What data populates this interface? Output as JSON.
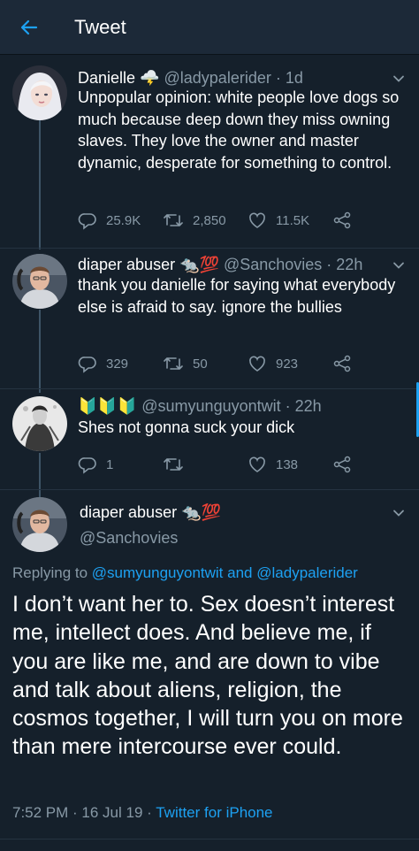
{
  "header": {
    "title": "Tweet"
  },
  "tweets": [
    {
      "name": "Danielle",
      "emoji": "🌩️",
      "handle": "@ladypalerider",
      "time": "· 1d",
      "text": "Unpopular opinion: white people love dogs so much because deep down they miss owning slaves. They love the owner and master dynamic, desperate for something to control.",
      "replies": "25.9K",
      "retweets": "2,850",
      "likes": "11.5K"
    },
    {
      "name": "diaper abuser",
      "emoji": "🐀💯",
      "handle": "@Sanchovies",
      "time": "· 22h",
      "text": "thank you danielle for saying what everybody else is afraid to say. ignore the bullies",
      "replies": "329",
      "retweets": "50",
      "likes": "923"
    },
    {
      "name": "🔰🔰🔰",
      "handle": "@sumyunguyontwit",
      "time": "· 22h",
      "text": "Shes not gonna suck your dick",
      "replies": "1",
      "retweets": "",
      "likes": "138"
    }
  ],
  "main_tweet": {
    "name": "diaper abuser",
    "emoji": "🐀💯",
    "handle": "@Sanchovies",
    "replying_prefix": "Replying to",
    "replying_user1": "@sumyunguyontwit",
    "replying_and": "and",
    "replying_user2": "@ladypalerider",
    "text": "I don’t want her to. Sex doesn’t interest me, intellect does. And believe me, if you are like me, and are down to vibe and talk about aliens, religion, the cosmos together, I will turn you on more than mere intercourse ever could.",
    "time": "7:52 PM · 16 Jul 19 ·",
    "client": "Twitter for iPhone"
  },
  "colors": {
    "background": "#15202b",
    "accent": "#1da1f2",
    "muted": "#8899a6",
    "header": "#1c2938"
  }
}
